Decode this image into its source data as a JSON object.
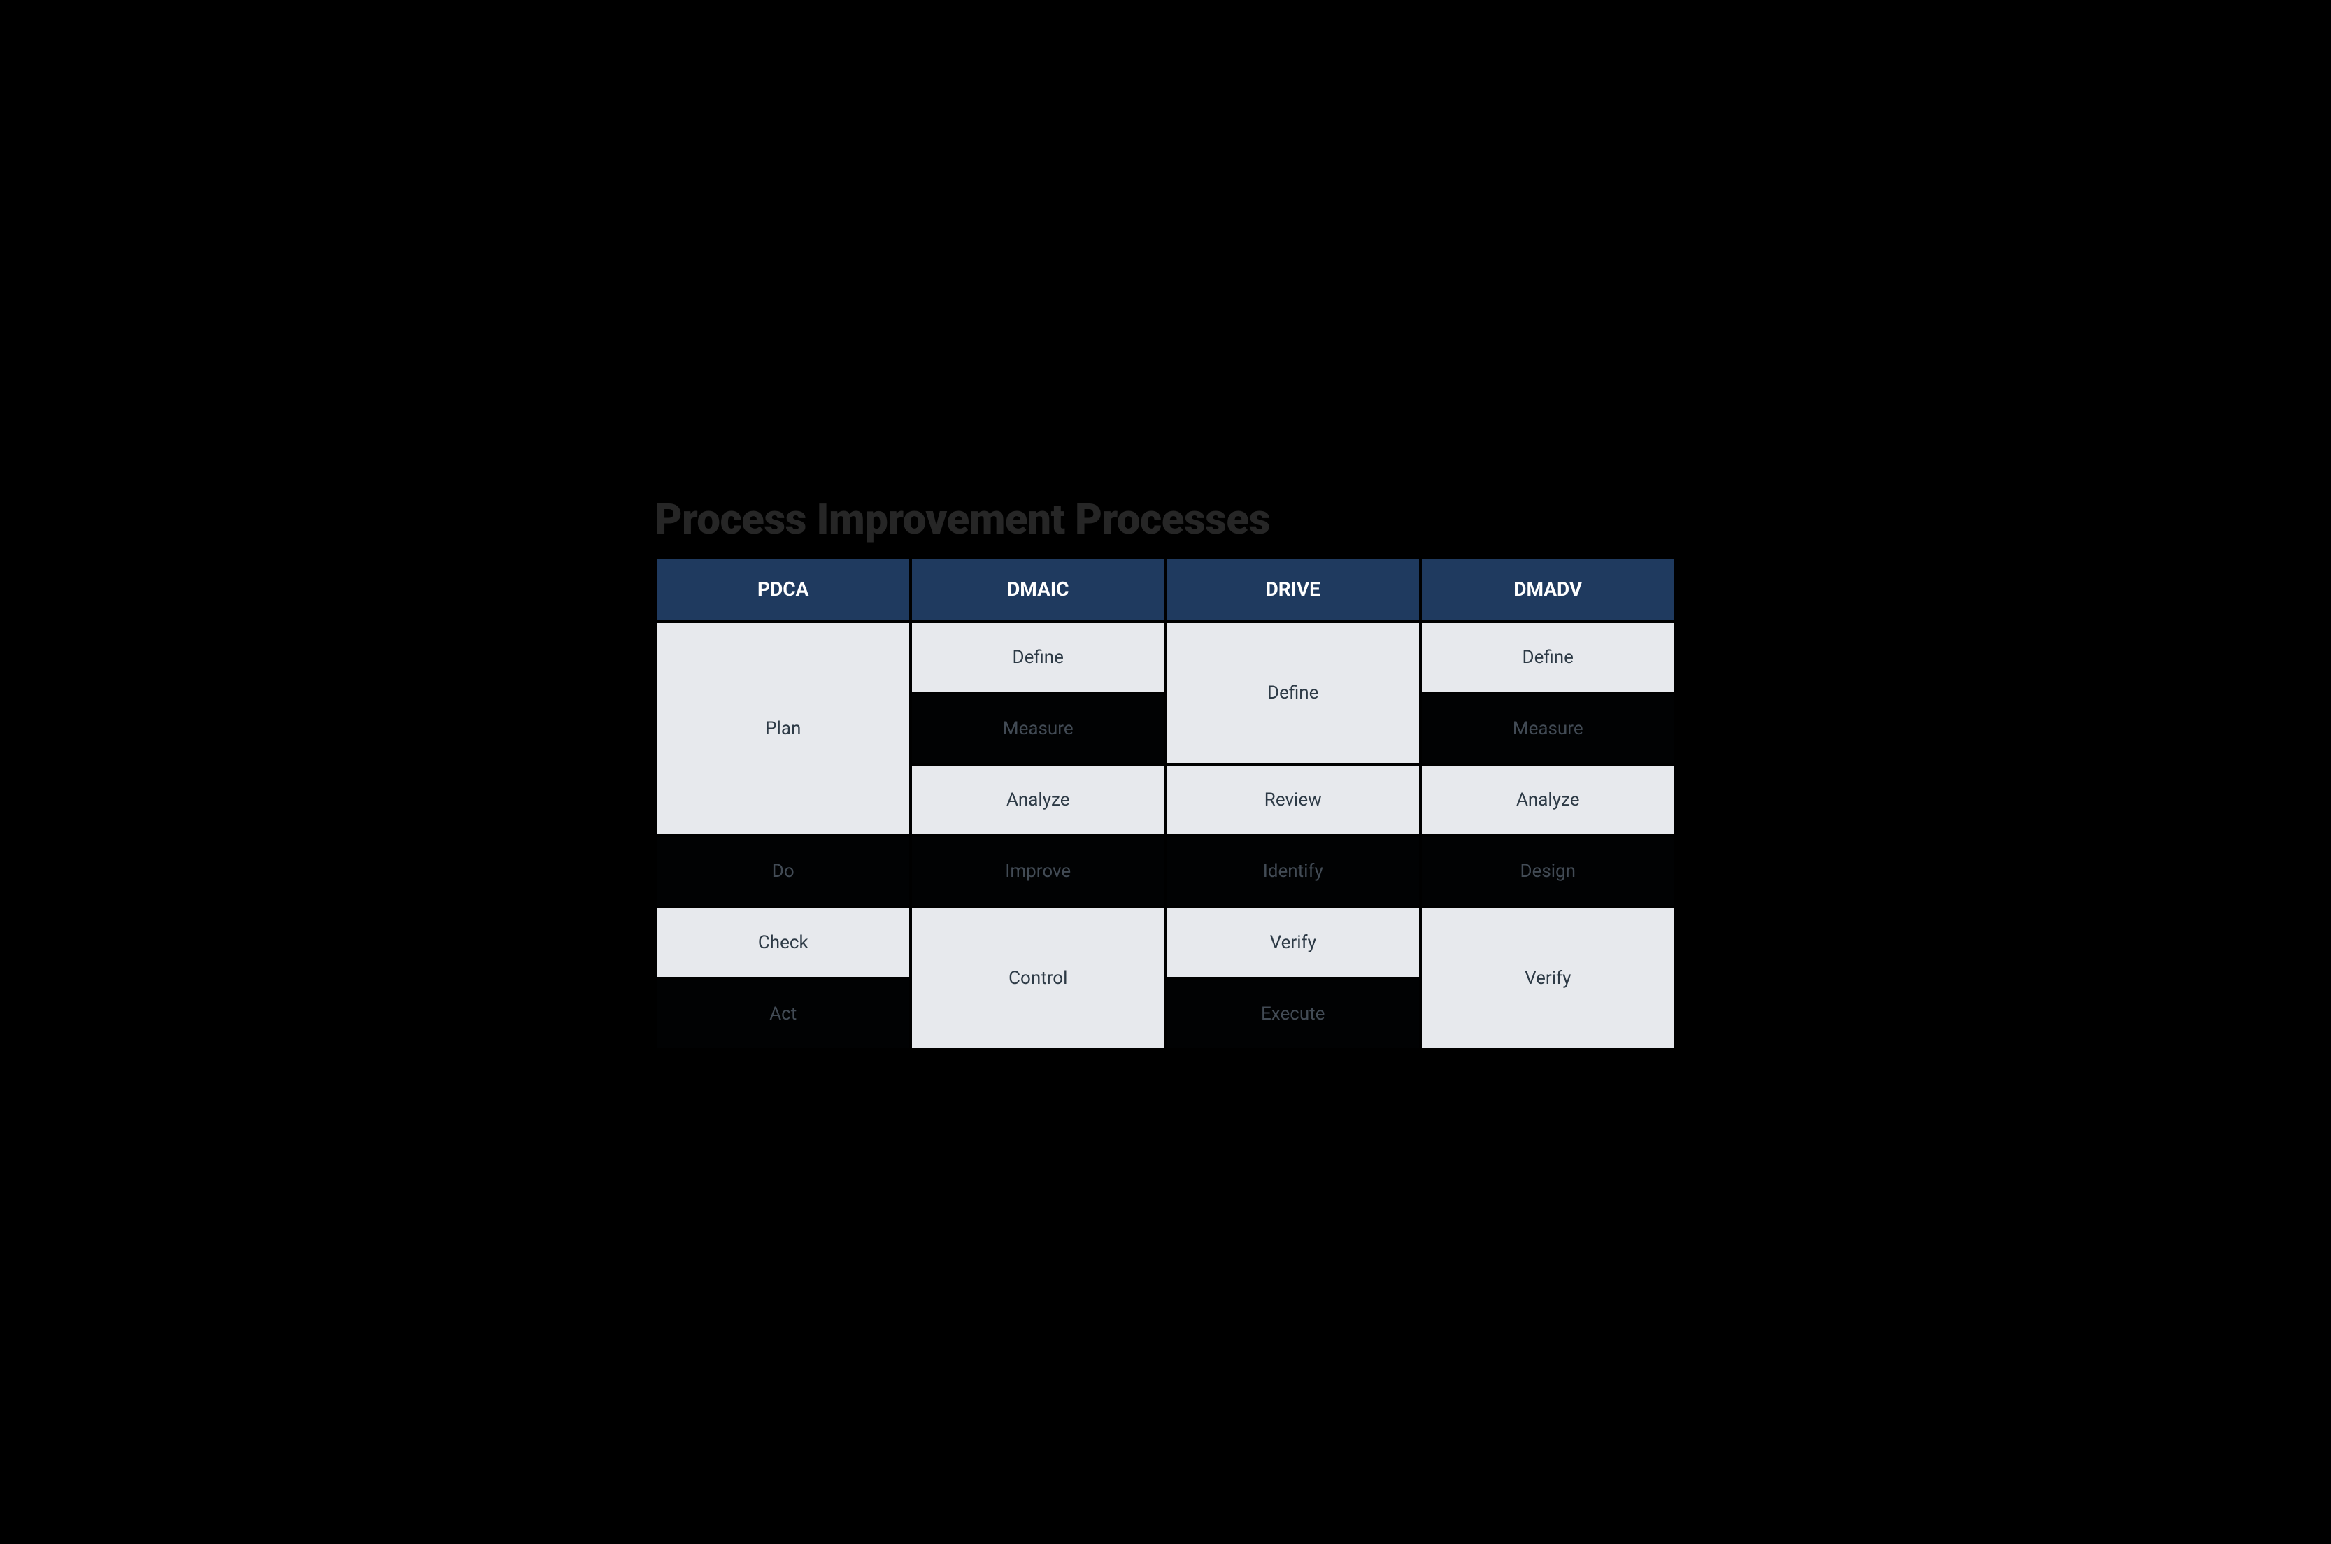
{
  "title": "Process Improvement Processes",
  "headers": [
    "PDCA",
    "DMAIC",
    "DRIVE",
    "DMADV"
  ],
  "pdca": {
    "plan": "Plan",
    "do": "Do",
    "check": "Check",
    "act": "Act"
  },
  "dmaic": {
    "define": "Define",
    "measure": "Measure",
    "analyze": "Analyze",
    "improve": "Improve",
    "control": "Control"
  },
  "drive": {
    "define": "Define",
    "review": "Review",
    "identify": "Identify",
    "verify": "Verify",
    "execute": "Execute"
  },
  "dmadv": {
    "define": "Define",
    "measure": "Measure",
    "analyze": "Analyze",
    "design": "Design",
    "verify": "Verify"
  }
}
